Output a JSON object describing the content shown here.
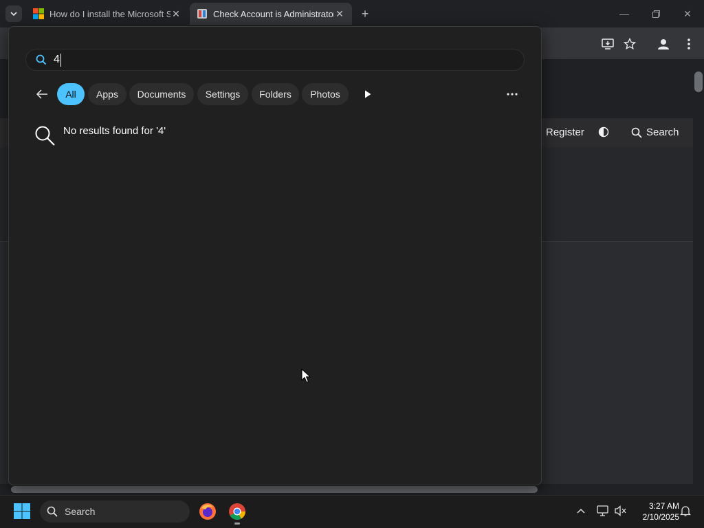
{
  "browser": {
    "tabs": [
      {
        "title": "How do I install the Microsoft S",
        "active": false,
        "favicon": "microsoft-logo"
      },
      {
        "title": "Check Account is Administrator",
        "active": true,
        "favicon": "site-logo"
      }
    ]
  },
  "site": {
    "nav": {
      "register": "Register",
      "search": "Search"
    }
  },
  "start_search": {
    "query": "4",
    "filters": [
      "All",
      "Apps",
      "Documents",
      "Settings",
      "Folders",
      "Photos"
    ],
    "selected_filter": "All",
    "no_results": "No results found for '4'",
    "accent": "#4cc2ff"
  },
  "taskbar": {
    "search_label": "Search",
    "time": "3:27 AM",
    "date": "2/10/2025",
    "apps": [
      "firefox",
      "chrome"
    ]
  }
}
